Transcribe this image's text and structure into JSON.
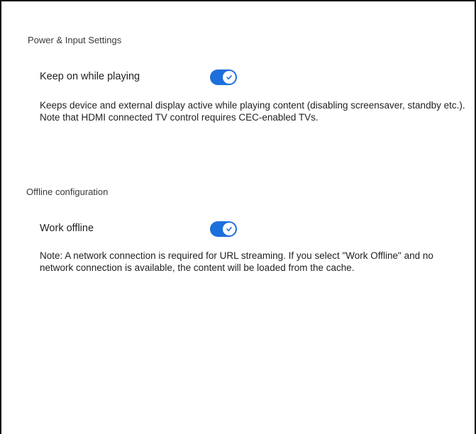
{
  "theme": {
    "accent": "#1d6fdc"
  },
  "power_section": {
    "title": "Power & Input Settings",
    "keep_on": {
      "label": "Keep on while playing",
      "enabled": true
    },
    "description_lines": [
      "Keeps device and external display active while playing content (disabling screensaver, standby etc.).",
      "Note that HDMI connected TV control requires CEC-enabled TVs."
    ]
  },
  "offline_section": {
    "title": "Offline configuration",
    "work_offline": {
      "label": "Work offline",
      "enabled": true
    },
    "description": "Note: A network connection is required for URL streaming. If you select \"Work Offline\" and no network connection is available, the content will be loaded from the cache."
  },
  "icons": {
    "toggle_check": "checkmark-icon"
  }
}
